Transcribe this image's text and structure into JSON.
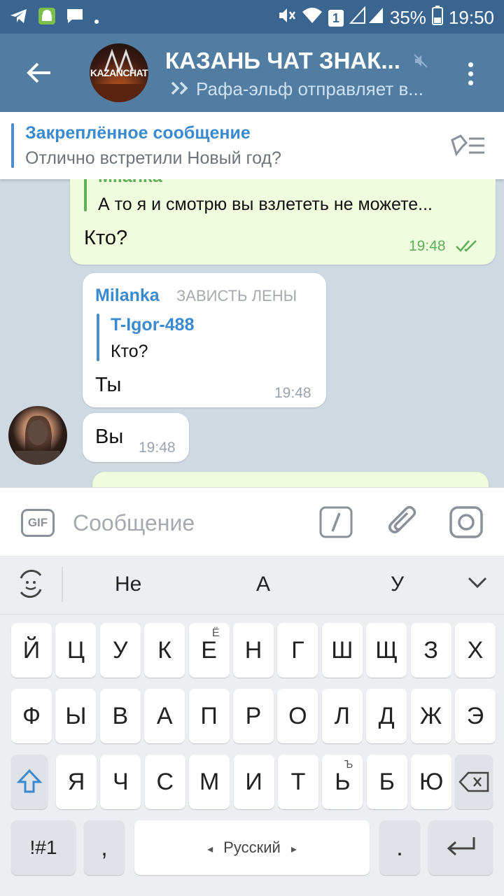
{
  "status_bar": {
    "battery": "35%",
    "time": "19:50",
    "sim_badge": "1"
  },
  "header": {
    "avatar_text": "KAZANCHAT",
    "title": "КАЗАНЬ ЧАТ ЗНАК...",
    "subtitle": "Рафа-эльф отправляет в..."
  },
  "pinned": {
    "title": "Закреплённое сообщение",
    "text": "Отлично встретили Новый год?"
  },
  "messages": {
    "m1": {
      "reply_author": "Milanka",
      "reply_text": "А то я и смотрю вы взлететь не можете...",
      "text": "Кто?",
      "time": "19:48"
    },
    "m2": {
      "author": "Milanka",
      "author_title": "ЗАВИСТЬ ЛЕНЫ",
      "reply_author": "T-Igor-488",
      "reply_text": "Кто?",
      "text": "Ты",
      "time": "19:48"
    },
    "m3": {
      "text": "Вы",
      "time": "19:48"
    }
  },
  "input": {
    "placeholder": "Сообщение",
    "gif_label": "GIF"
  },
  "keyboard": {
    "suggestions": [
      "Не",
      "А",
      "У"
    ],
    "row1": [
      "Й",
      "Ц",
      "У",
      "К",
      "Е",
      "Н",
      "Г",
      "Ш",
      "Щ",
      "З",
      "Х"
    ],
    "row1_sub": "Ё",
    "row2": [
      "Ф",
      "Ы",
      "В",
      "А",
      "П",
      "Р",
      "О",
      "Л",
      "Д",
      "Ж",
      "Э"
    ],
    "row3": [
      "Я",
      "Ч",
      "С",
      "М",
      "И",
      "Т",
      "Ь",
      "Б",
      "Ю"
    ],
    "row3_sub": "Ъ",
    "symbols": "!#1",
    "comma": ",",
    "space_label": "Русский",
    "period": "."
  },
  "colors": {
    "header": "#517da2",
    "status": "#3a6591",
    "accent": "#3a8ad0",
    "outgoing": "#effdde"
  }
}
